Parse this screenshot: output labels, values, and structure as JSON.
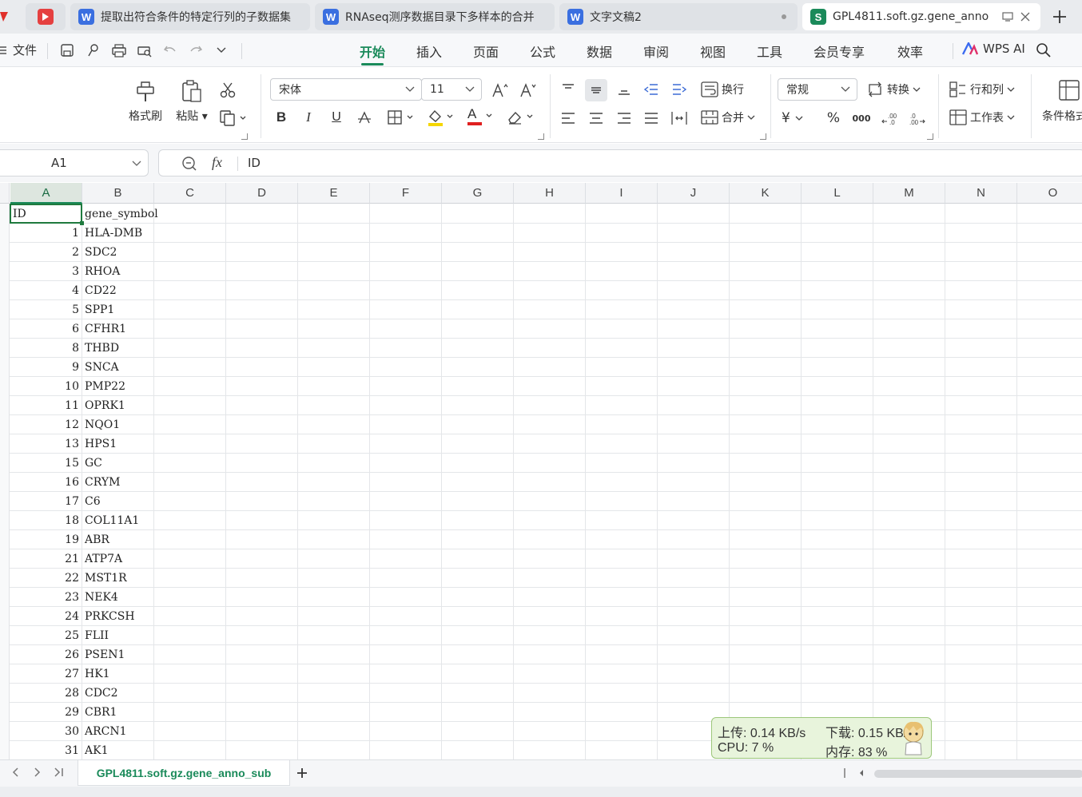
{
  "tabs": [
    {
      "title": "提取出符合条件的特定行列的子数据集",
      "app": "W",
      "color": "#3a6fe0"
    },
    {
      "title": "RNAseq测序数据目录下多样本的合并",
      "app": "W",
      "color": "#3a6fe0"
    },
    {
      "title": "文字文稿2",
      "app": "W",
      "color": "#3a6fe0"
    },
    {
      "title": "GPL4811.soft.gz.gene_anno",
      "app": "S",
      "color": "#1a8a5a"
    }
  ],
  "menu": {
    "file": "文件",
    "tabs": [
      "开始",
      "插入",
      "页面",
      "公式",
      "数据",
      "审阅",
      "视图",
      "工具",
      "会员专享",
      "效率"
    ],
    "active": "开始",
    "wps_ai": "WPS AI"
  },
  "ribbon": {
    "format_painter": "格式刷",
    "paste": "粘贴",
    "font_name": "宋体",
    "font_size": "11",
    "wrap": "换行",
    "merge": "合并",
    "number_format": "常规",
    "convert": "转换",
    "rows_cols": "行和列",
    "worksheet": "工作表",
    "conditional": "条件格式",
    "bold": "B",
    "italic": "I",
    "underline": "U",
    "font_color_glyph": "A",
    "currency": "¥",
    "percent": "%",
    "thousands": "000",
    "colors": {
      "fill": "#f5d600",
      "font": "#e02020"
    }
  },
  "formula_bar": {
    "name_box": "A1",
    "fx_label": "fx",
    "value": "ID"
  },
  "grid": {
    "columns": [
      "A",
      "B",
      "C",
      "D",
      "E",
      "F",
      "G",
      "H",
      "I",
      "J",
      "K",
      "L",
      "M",
      "N",
      "O"
    ],
    "header_row": {
      "a": "ID",
      "b": "gene_symbol"
    },
    "rows": [
      {
        "id": "1",
        "symbol": "HLA-DMB"
      },
      {
        "id": "2",
        "symbol": "SDC2"
      },
      {
        "id": "3",
        "symbol": "RHOA"
      },
      {
        "id": "4",
        "symbol": "CD22"
      },
      {
        "id": "5",
        "symbol": "SPP1"
      },
      {
        "id": "6",
        "symbol": "CFHR1"
      },
      {
        "id": "8",
        "symbol": "THBD"
      },
      {
        "id": "9",
        "symbol": "SNCA"
      },
      {
        "id": "10",
        "symbol": "PMP22"
      },
      {
        "id": "11",
        "symbol": "OPRK1"
      },
      {
        "id": "12",
        "symbol": "NQO1"
      },
      {
        "id": "13",
        "symbol": "HPS1"
      },
      {
        "id": "15",
        "symbol": "GC"
      },
      {
        "id": "16",
        "symbol": "CRYM"
      },
      {
        "id": "17",
        "symbol": "C6"
      },
      {
        "id": "18",
        "symbol": "COL11A1"
      },
      {
        "id": "19",
        "symbol": "ABR"
      },
      {
        "id": "21",
        "symbol": "ATP7A"
      },
      {
        "id": "22",
        "symbol": "MST1R"
      },
      {
        "id": "23",
        "symbol": "NEK4"
      },
      {
        "id": "24",
        "symbol": "PRKCSH"
      },
      {
        "id": "25",
        "symbol": "FLII"
      },
      {
        "id": "26",
        "symbol": "PSEN1"
      },
      {
        "id": "27",
        "symbol": "HK1"
      },
      {
        "id": "28",
        "symbol": "CDC2"
      },
      {
        "id": "29",
        "symbol": "CBR1"
      },
      {
        "id": "30",
        "symbol": "ARCN1"
      },
      {
        "id": "31",
        "symbol": "AK1"
      }
    ]
  },
  "sheet": {
    "name": "GPL4811.soft.gz.gene_anno_sub",
    "add": "+"
  },
  "netmon": {
    "upload": "上传: 0.14 KB/s",
    "download": "下载: 0.15 KB/s",
    "cpu": "CPU: 7 %",
    "mem": "内存: 83 %"
  }
}
